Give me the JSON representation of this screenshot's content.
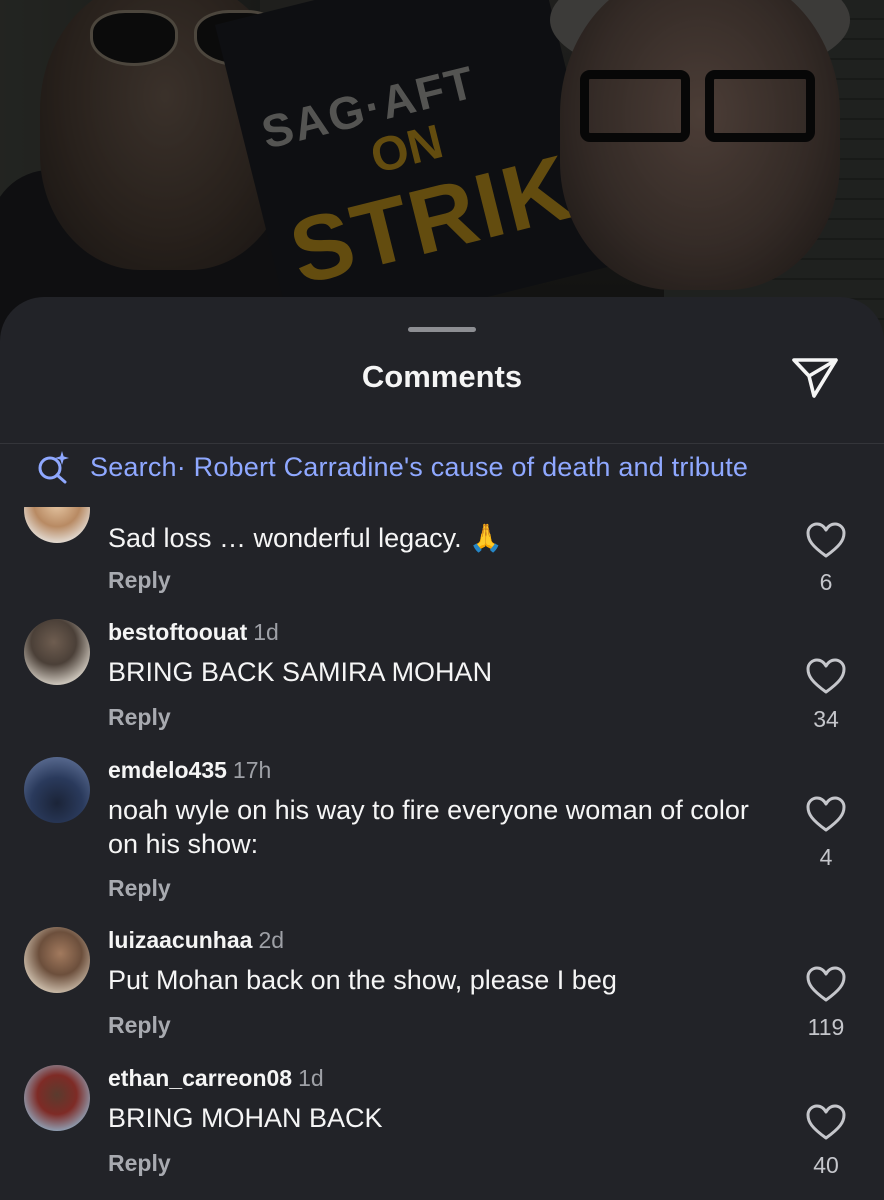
{
  "sheet": {
    "title": "Comments",
    "search_prefix": "Search",
    "search_query": " · Robert Carradine's cause of death and tribute"
  },
  "photo": {
    "sign_lines": [
      "SAG·AFT",
      "ON",
      "STRIK"
    ]
  },
  "comments": [
    {
      "username": "",
      "time": "",
      "text": "Sad loss … wonderful legacy. 🙏",
      "reply_label": "Reply",
      "likes": "6"
    },
    {
      "username": "bestoftoouat",
      "time": "1d",
      "text": "BRING BACK SAMIRA MOHAN",
      "reply_label": "Reply",
      "likes": "34"
    },
    {
      "username": "emdelo435",
      "time": "17h",
      "text": "noah wyle on his way to fire everyone woman of color on his show:",
      "reply_label": "Reply",
      "likes": "4"
    },
    {
      "username": "luizaacunhaa",
      "time": "2d",
      "text": "Put Mohan back on the show, please I beg",
      "reply_label": "Reply",
      "likes": "119"
    },
    {
      "username": "ethan_carreon08",
      "time": "1d",
      "text": "BRING MOHAN BACK",
      "reply_label": "Reply",
      "likes": "40"
    }
  ],
  "icons": {
    "share": "paper-plane-icon",
    "search": "sparkle-search-icon",
    "like": "heart-outline-icon"
  },
  "colors": {
    "sheet_bg": "#222328",
    "search_link": "#8fa8ff",
    "muted": "#a8aab0"
  }
}
